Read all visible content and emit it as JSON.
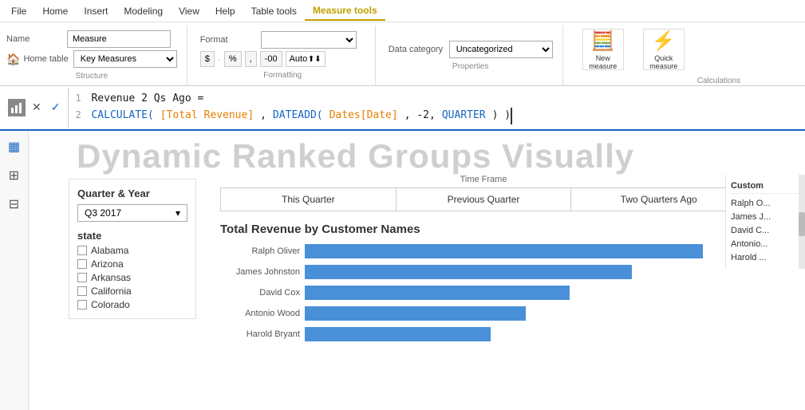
{
  "menu": {
    "items": [
      {
        "label": "File",
        "active": false
      },
      {
        "label": "Home",
        "active": false
      },
      {
        "label": "Insert",
        "active": false
      },
      {
        "label": "Modeling",
        "active": false
      },
      {
        "label": "View",
        "active": false
      },
      {
        "label": "Help",
        "active": false
      },
      {
        "label": "Table tools",
        "active": false
      },
      {
        "label": "Measure tools",
        "active": true
      }
    ]
  },
  "ribbon": {
    "structure_label": "Structure",
    "formatting_label": "Formatting",
    "properties_label": "Properties",
    "calculations_label": "Calculations",
    "name_label": "Name",
    "name_value": "Measure",
    "home_table_label": "Home table",
    "home_table_value": "Key Measures",
    "format_label": "Format",
    "format_value": "",
    "data_category_label": "Data category",
    "data_category_value": "Uncategorized",
    "dollar_label": "$",
    "pct_label": "%",
    "comma_label": ",",
    "dec_minus_label": "-00",
    "auto_label": "Auto",
    "new_measure_label": "New\nmeasure",
    "quick_measure_label": "Quick\nmeasure"
  },
  "formula": {
    "line1_num": "1",
    "line1_text": "Revenue 2 Qs Ago =",
    "line2_num": "2",
    "line2_func": "CALCULATE(",
    "line2_measure": "[Total Revenue]",
    "line2_dateadd": "DATEADD(",
    "line2_field": "Dates[Date]",
    "line2_args": ", -2,",
    "line2_quarter": "QUARTER",
    "line2_close": ") )"
  },
  "page": {
    "title": "Dynamic Ranked Groups Visually"
  },
  "quarter_year": {
    "section_label": "Quarter & Year",
    "value": "Q3 2017"
  },
  "state": {
    "label": "state",
    "items": [
      {
        "name": "Alabama",
        "checked": false
      },
      {
        "name": "Arizona",
        "checked": false
      },
      {
        "name": "Arkansas",
        "checked": false
      },
      {
        "name": "California",
        "checked": false
      },
      {
        "name": "Colorado",
        "checked": false
      }
    ]
  },
  "time_frame": {
    "label": "Time Frame",
    "buttons": [
      {
        "label": "This Quarter",
        "active": false
      },
      {
        "label": "Previous Quarter",
        "active": false
      },
      {
        "label": "Two Quarters Ago",
        "active": false
      }
    ]
  },
  "chart": {
    "title": "Total Revenue by Customer Names",
    "bars": [
      {
        "label": "Ralph Oliver",
        "pct": 90
      },
      {
        "label": "James Johnston",
        "pct": 74
      },
      {
        "label": "David Cox",
        "pct": 60
      },
      {
        "label": "Antonio Wood",
        "pct": 50
      },
      {
        "label": "Harold Bryant",
        "pct": 42
      }
    ]
  },
  "right_panel": {
    "title": "Custom",
    "items": [
      {
        "label": "Ralph O..."
      },
      {
        "label": "James J..."
      },
      {
        "label": "David C..."
      },
      {
        "label": "Antonio..."
      },
      {
        "label": "Harold ..."
      }
    ]
  },
  "sidebar_icons": [
    {
      "name": "bar-chart-icon",
      "symbol": "▦"
    },
    {
      "name": "table-icon",
      "symbol": "⊞"
    },
    {
      "name": "model-icon",
      "symbol": "⊟"
    }
  ]
}
